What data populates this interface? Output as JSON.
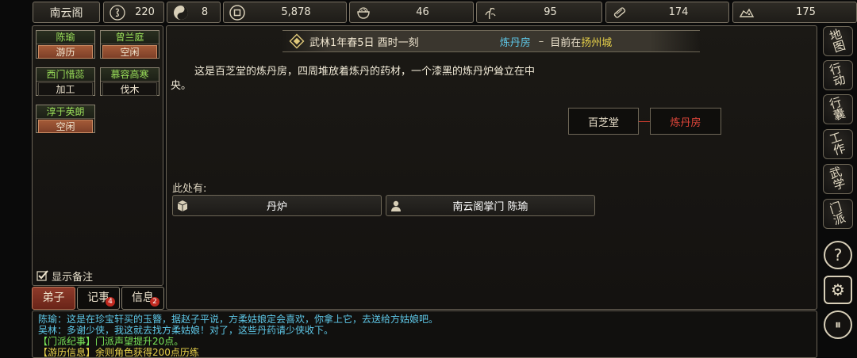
{
  "topbar": {
    "sect_name": "南云阁",
    "stats": [
      {
        "icon": "gourd-icon",
        "value": "220"
      },
      {
        "icon": "yin-yang-icon",
        "value": "8"
      },
      {
        "icon": "coin-icon",
        "value": "5,878"
      },
      {
        "icon": "rice-bowl-icon",
        "value": "46"
      },
      {
        "icon": "herb-icon",
        "value": "95"
      },
      {
        "icon": "wood-icon",
        "value": "174"
      },
      {
        "icon": "ore-icon",
        "value": "175"
      }
    ]
  },
  "disciples": [
    {
      "name": "陈瑜",
      "status": "游历",
      "busy": true
    },
    {
      "name": "曾兰庭",
      "status": "空闲",
      "busy": true
    },
    {
      "name": "西门惜蕊",
      "status": "加工",
      "busy": false
    },
    {
      "name": "慕容高寒",
      "status": "伐木",
      "busy": false
    },
    {
      "name": "淳于英朗",
      "status": "空闲",
      "busy": true
    }
  ],
  "show_notes_label": "显示备注",
  "bottom_tabs": {
    "disciples": "弟子",
    "records": "记事",
    "records_badge": "4",
    "messages": "信息",
    "messages_badge": "2"
  },
  "header": {
    "date": "武林1年春5日 酉时一刻",
    "room": "炼丹房",
    "separator": "–",
    "location_prefix": "目前在",
    "city": "扬州城"
  },
  "description": "这是百芝堂的炼丹房，四周堆放着炼丹的药材，一个漆黑的炼丹炉耸立在中央。",
  "places": {
    "parent": "百芝堂",
    "current": "炼丹房"
  },
  "here_label": "此处有:",
  "here_items": [
    {
      "icon": "box-icon",
      "label": "丹炉"
    },
    {
      "icon": "person-icon",
      "label": "南云阁掌门 陈瑜"
    }
  ],
  "side_menu": [
    {
      "chars": [
        "地",
        "图"
      ]
    },
    {
      "chars": [
        "行",
        "动"
      ]
    },
    {
      "chars": [
        "行",
        "囊"
      ]
    },
    {
      "chars": [
        "工",
        "作"
      ]
    },
    {
      "chars": [
        "武",
        "学"
      ]
    },
    {
      "chars": [
        "门",
        "派"
      ]
    }
  ],
  "side_round": {
    "help": "?",
    "settings": "⚙",
    "pause": "⏸"
  },
  "log": [
    {
      "text": "陈瑜：这是在珍宝轩买的玉簪，据赵子平说，方柔姑娘定会喜欢，你拿上它，去送给方姑娘吧。",
      "color": "#5ec8e8"
    },
    {
      "text": "吴林：多谢少侠，我这就去找方柔姑娘！对了，这些丹药请少侠收下。",
      "color": "#5ec8e8"
    },
    {
      "text": "【门派纪事】门派声望提升20点。",
      "color": "#7ae85a"
    },
    {
      "text": "【游历信息】余则角色获得200点历练",
      "color": "#e8d24a"
    }
  ],
  "colors": {
    "accent_green": "#9be05a",
    "city_yellow": "#e8d24a",
    "room_cyan": "#5ec8e8",
    "current_red": "#e0463a"
  }
}
